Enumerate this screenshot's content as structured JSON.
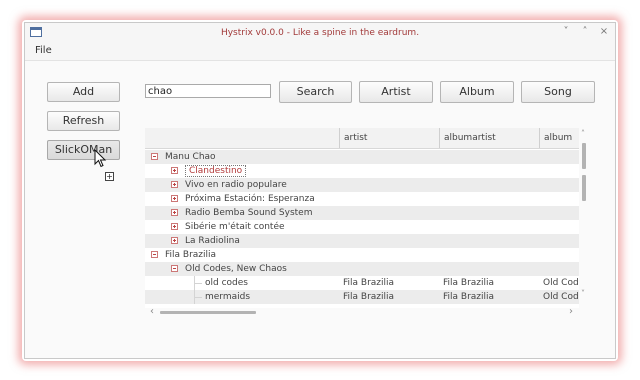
{
  "window": {
    "title": "Hystrix v0.0.0 - Like a spine in the eardrum.",
    "controls": {
      "minimize": "˅",
      "maximize": "˄",
      "close": "×"
    }
  },
  "menu": {
    "file": "File"
  },
  "left_buttons": {
    "add": "Add",
    "refresh": "Refresh",
    "slick_label": "SlickOMan"
  },
  "drag_indicator": "+",
  "search": {
    "value": "chao",
    "button": "Search"
  },
  "filters": {
    "artist": "Artist",
    "album": "Album",
    "song": "Song"
  },
  "table": {
    "columns": [
      "",
      "artist",
      "albumartist",
      "album"
    ],
    "rows": [
      {
        "level": 0,
        "toggle": "minus",
        "label": "Manu Chao",
        "artist": "",
        "albumartist": "",
        "album": ""
      },
      {
        "level": 1,
        "toggle": "plus",
        "label": "Clandestino",
        "artist": "",
        "albumartist": "",
        "album": ""
      },
      {
        "level": 1,
        "toggle": "plus",
        "label": "Vivo en radio populare",
        "artist": "",
        "albumartist": "",
        "album": ""
      },
      {
        "level": 1,
        "toggle": "plus",
        "label": "Próxima Estación: Esperanza",
        "artist": "",
        "albumartist": "",
        "album": ""
      },
      {
        "level": 1,
        "toggle": "plus",
        "label": "Radio Bemba Sound System",
        "artist": "",
        "albumartist": "",
        "album": ""
      },
      {
        "level": 1,
        "toggle": "plus",
        "label": "Sibérie m'était contée",
        "artist": "",
        "albumartist": "",
        "album": ""
      },
      {
        "level": 1,
        "toggle": "plus",
        "label": "La Radiolina",
        "artist": "",
        "albumartist": "",
        "album": ""
      },
      {
        "level": 0,
        "toggle": "minus",
        "label": "Fila Brazilia",
        "artist": "",
        "albumartist": "",
        "album": ""
      },
      {
        "level": 1,
        "toggle": "minus",
        "label": "Old Codes, New Chaos",
        "artist": "",
        "albumartist": "",
        "album": ""
      },
      {
        "level": 2,
        "toggle": "",
        "label": "old codes",
        "artist": "Fila Brazilia",
        "albumartist": "Fila Brazilia",
        "album": "Old Cod"
      },
      {
        "level": 2,
        "toggle": "",
        "label": "mermaids",
        "artist": "Fila Brazilia",
        "albumartist": "Fila Brazilia",
        "album": "Old Cod"
      }
    ],
    "selected_row": 1
  },
  "scrollbars": {
    "up": "˄",
    "down": "˅",
    "left": "‹",
    "right": "›"
  },
  "colors": {
    "accent_red": "#a23a3a",
    "window_glow": "#e86e6e",
    "row_alt": "#ececec"
  }
}
